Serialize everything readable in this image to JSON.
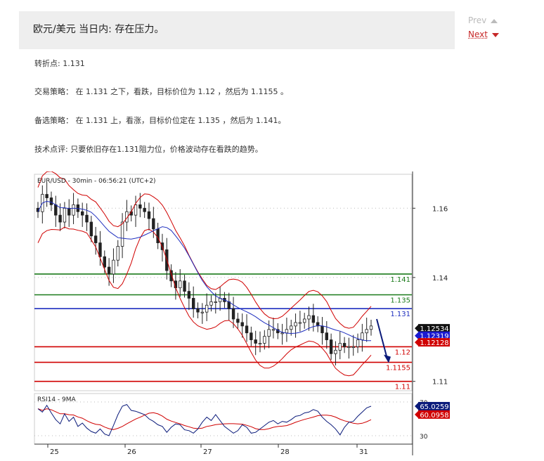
{
  "header": {
    "title": "欧元/美元 当日内: 存在压力。",
    "prev": "Prev",
    "next": "Next"
  },
  "analysis": {
    "pivot": {
      "label": "转折点:",
      "value": "1.131"
    },
    "strategy": {
      "label": "交易策略：",
      "text": "在 1.131 之下，看跌，目标价位为 1.12 ，然后为 1.1155 。"
    },
    "alternative": {
      "label": "备选策略：",
      "text": "在 1.131 上，看涨，目标价位定在 1.135 ，然后为 1.141。"
    },
    "comment": {
      "label": "技术点评:",
      "text": "只要依旧存在1.131阻力位，价格波动存在看跌的趋势。"
    }
  },
  "chart_data": {
    "type": "candlestick",
    "title": "EUR/USD - 30min - 06:56:21 (UTC+2)",
    "price_axis": {
      "ticks": [
        1.16,
        1.14,
        1.11
      ]
    },
    "x_axis": {
      "ticks": [
        "25",
        "26",
        "27",
        "28",
        "31"
      ]
    },
    "levels": [
      {
        "label": "1.141",
        "value": 1.141,
        "color": "#1a7a1a"
      },
      {
        "label": "1.135",
        "value": 1.135,
        "color": "#1a7a1a"
      },
      {
        "label": "1.131",
        "value": 1.131,
        "color": "#1f2fbf"
      },
      {
        "label": "1.12",
        "value": 1.12,
        "color": "#d00000"
      },
      {
        "label": "1.1155",
        "value": 1.1155,
        "color": "#d00000"
      },
      {
        "label": "1.11",
        "value": 1.11,
        "color": "#d00000"
      }
    ],
    "price_tags": [
      {
        "label": "1.12534",
        "value": 1.12534,
        "bg": "#111111"
      },
      {
        "label": "1.12319",
        "value": 1.12319,
        "bg": "#1a1ad0"
      },
      {
        "label": "1.12128",
        "value": 1.12128,
        "bg": "#d00000"
      }
    ],
    "close_series": [
      1.159,
      1.164,
      1.163,
      1.161,
      1.158,
      1.156,
      1.16,
      1.158,
      1.161,
      1.159,
      1.158,
      1.156,
      1.152,
      1.15,
      1.146,
      1.143,
      1.141,
      1.145,
      1.149,
      1.156,
      1.159,
      1.158,
      1.161,
      1.16,
      1.159,
      1.157,
      1.154,
      1.15,
      1.148,
      1.142,
      1.139,
      1.137,
      1.139,
      1.136,
      1.134,
      1.131,
      1.13,
      1.13,
      1.132,
      1.133,
      1.133,
      1.134,
      1.133,
      1.131,
      1.128,
      1.127,
      1.126,
      1.124,
      1.122,
      1.121,
      1.121,
      1.123,
      1.125,
      1.125,
      1.124,
      1.124,
      1.125,
      1.126,
      1.127,
      1.127,
      1.128,
      1.129,
      1.127,
      1.126,
      1.124,
      1.122,
      1.118,
      1.119,
      1.121,
      1.12,
      1.12,
      1.12,
      1.122,
      1.124,
      1.125,
      1.126
    ],
    "rsi": {
      "label": "RSI14 - 9MA",
      "ticks": [
        70,
        30
      ],
      "rsi_value": "65.0259",
      "ma_value": "60.0958",
      "rsi_values": [
        62,
        58,
        66,
        57,
        49,
        44,
        56,
        47,
        52,
        41,
        45,
        39,
        35,
        33,
        38,
        32,
        30,
        42,
        55,
        65,
        67,
        60,
        59,
        57,
        55,
        50,
        47,
        43,
        41,
        34,
        40,
        44,
        43,
        37,
        36,
        33,
        38,
        46,
        52,
        48,
        55,
        48,
        41,
        37,
        33,
        36,
        43,
        40,
        33,
        34,
        38,
        42,
        46,
        48,
        44,
        47,
        46,
        49,
        53,
        54,
        57,
        58,
        61,
        59,
        52,
        47,
        43,
        38,
        31,
        40,
        46,
        47,
        53,
        58,
        63,
        65
      ]
    }
  }
}
